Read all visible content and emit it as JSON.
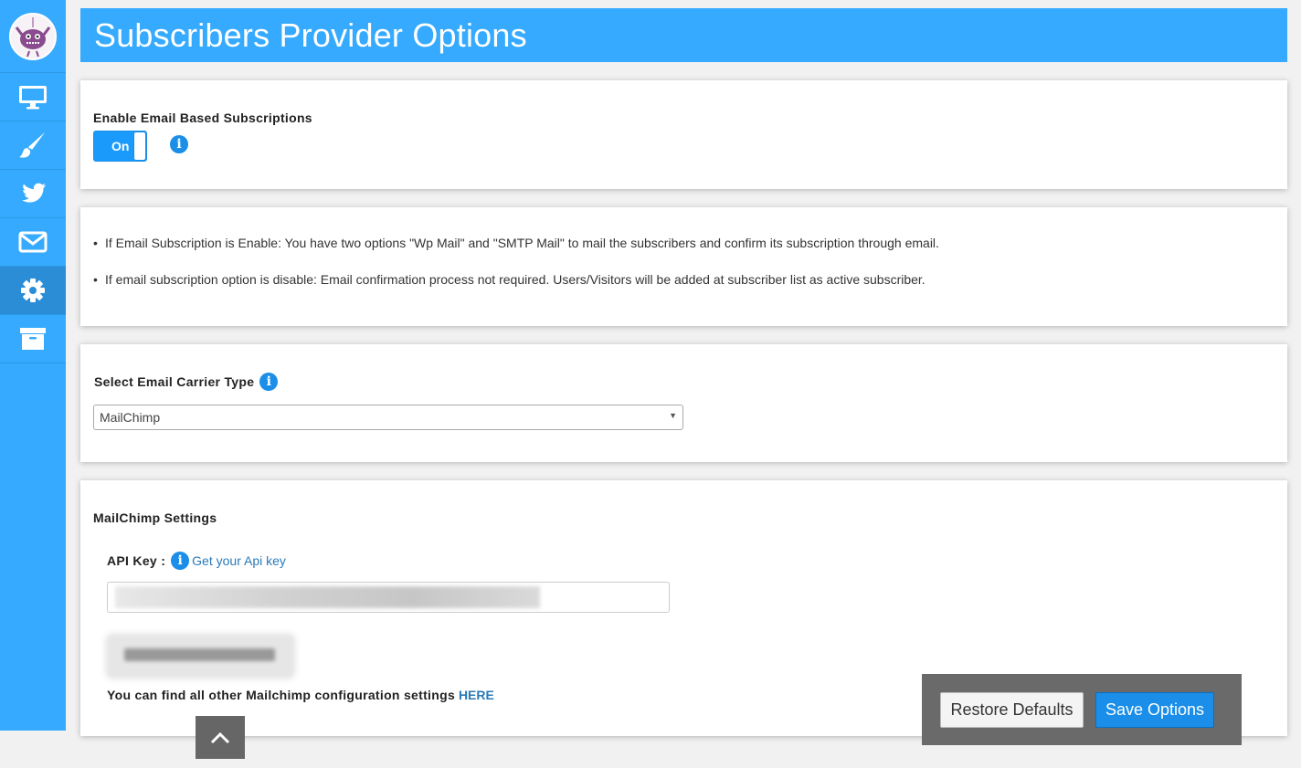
{
  "header": {
    "title": "Subscribers Provider Options"
  },
  "sidebar": {
    "items": [
      {
        "icon": "monitor-icon"
      },
      {
        "icon": "paintbrush-icon"
      },
      {
        "icon": "twitter-icon"
      },
      {
        "icon": "envelope-icon"
      },
      {
        "icon": "gear-icon",
        "active": true
      },
      {
        "icon": "archive-icon"
      }
    ]
  },
  "email_subscription": {
    "label": "Enable Email Based Subscriptions",
    "toggle_label": "On",
    "info_glyph": "i"
  },
  "notes": {
    "items": [
      "If Email Subscription is Enable: You have two options \"Wp Mail\" and \"SMTP Mail\" to mail the subscribers and confirm its subscription through email.",
      "If email subscription option is disable: Email confirmation process not required. Users/Visitors will be added at subscriber list as active subscriber."
    ]
  },
  "carrier": {
    "label": "Select Email Carrier Type",
    "selected": "MailChimp",
    "caret": "▼",
    "info_glyph": "i"
  },
  "mailchimp": {
    "section_title": "MailChimp Settings",
    "api_key_label": "API Key :",
    "api_key_link": "Get your Api key",
    "info_glyph": "i",
    "footer_text": "You can find all other Mailchimp configuration settings",
    "footer_link": "HERE"
  },
  "actions": {
    "restore_label": "Restore Defaults",
    "save_label": "Save Options"
  },
  "colors": {
    "accent": "#35aaff",
    "primary_button": "#1a8ee8",
    "action_bar": "#6a6a6a"
  }
}
